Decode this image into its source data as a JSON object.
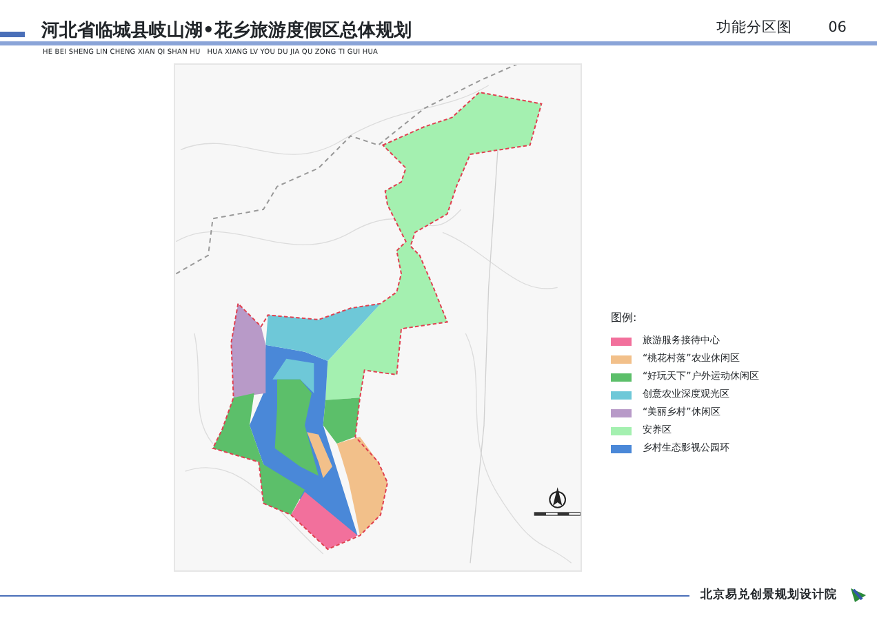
{
  "header": {
    "title": "河北省临城县岐山湖•花乡旅游度假区总体规划",
    "subtitle": "HE BEI SHENG LIN CHENG XIAN QI SHAN HU   HUA XIANG LV YOU DU JIA QU ZONG TI GUI HUA",
    "section": "功能分区图",
    "page_number": "06"
  },
  "legend": {
    "title": "图例:",
    "items": [
      {
        "label": "旅游服务接待中心",
        "color": "#f2709c"
      },
      {
        "label": "“桃花村落”农业休闲区",
        "color": "#f2c08a"
      },
      {
        "label": "“好玩天下”户外运动休闲区",
        "color": "#5cbf6a"
      },
      {
        "label": "创意农业深度观光区",
        "color": "#6ec8d8"
      },
      {
        "label": "“美丽乡村”休闲区",
        "color": "#b89ac8"
      },
      {
        "label": "安养区",
        "color": "#a4f0b0"
      },
      {
        "label": "乡村生态影视公园环",
        "color": "#4a88d8"
      }
    ]
  },
  "footer": {
    "institute": "北京易兑创景规划设计院"
  }
}
